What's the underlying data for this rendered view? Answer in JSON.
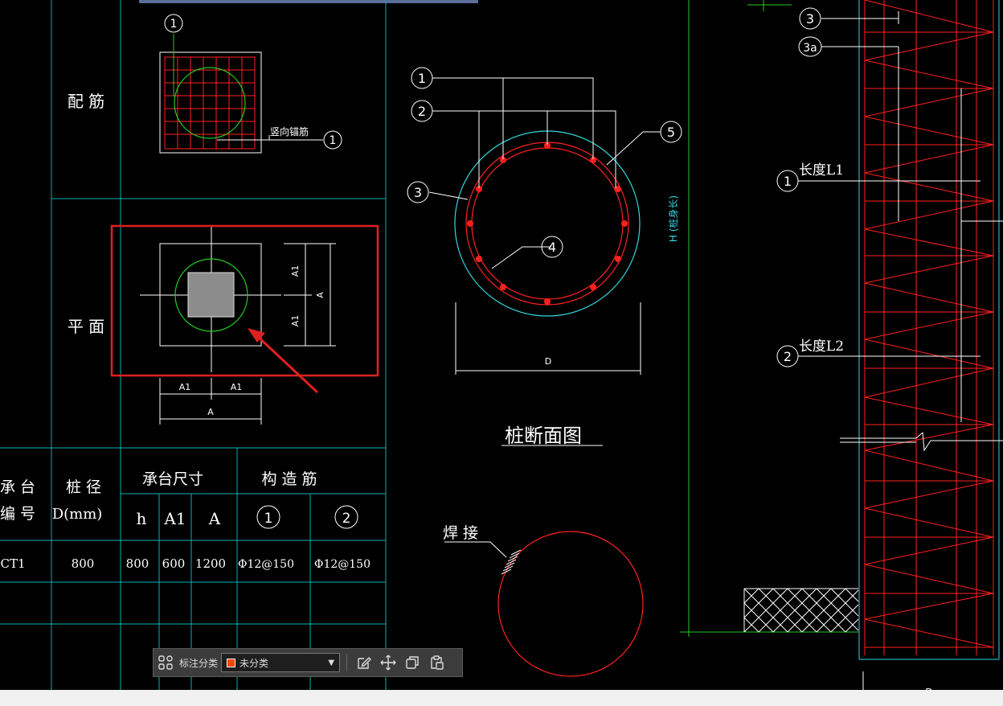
{
  "colors": {
    "background": "#000000",
    "grid": "#00b3b3",
    "red": "#ff2020",
    "green": "#22cc22",
    "white": "#ffffff",
    "cyan": "#33d6e0",
    "highlight": "#e02020",
    "swatch": "#ff4400"
  },
  "left_panel": {
    "row_label_rebar": "配 筋",
    "row_label_plan": "平 面",
    "callout_vertical_anchor": "竖向锚筋",
    "callout_num_1": "1",
    "dim_A1": "A1",
    "dim_A": "A"
  },
  "table": {
    "headers": {
      "cap_no": "承 台\n编 号",
      "pile_dia": "桩 径\nD(mm)",
      "cap_size": "承台尺寸",
      "struct_rebar": "构 造 筋",
      "h": "h",
      "a1": "A1",
      "a": "A",
      "rebar1": "1",
      "rebar2": "2"
    },
    "rows": [
      {
        "cap_no": "CT1",
        "pile_dia": "800",
        "h": "800",
        "a1": "600",
        "a": "1200",
        "rebar1": "Φ12@150",
        "rebar2": "Φ12@150"
      }
    ]
  },
  "section": {
    "title": "桩断面图",
    "dim_D": "D",
    "weld_label": "焊 接",
    "callouts": [
      "1",
      "2",
      "3",
      "4",
      "5"
    ],
    "side_label": "H (桩身长)"
  },
  "elevation": {
    "callouts": [
      "3",
      "3a",
      "1",
      "2"
    ],
    "length_L1": "长度L1",
    "length_L2": "长度L2",
    "bottom_label": "D"
  },
  "toolbar": {
    "label": "标注分类",
    "select_value": "未分类",
    "icons": [
      "apps-icon",
      "edit-icon",
      "move-icon",
      "copy-icon",
      "paste-icon"
    ]
  }
}
